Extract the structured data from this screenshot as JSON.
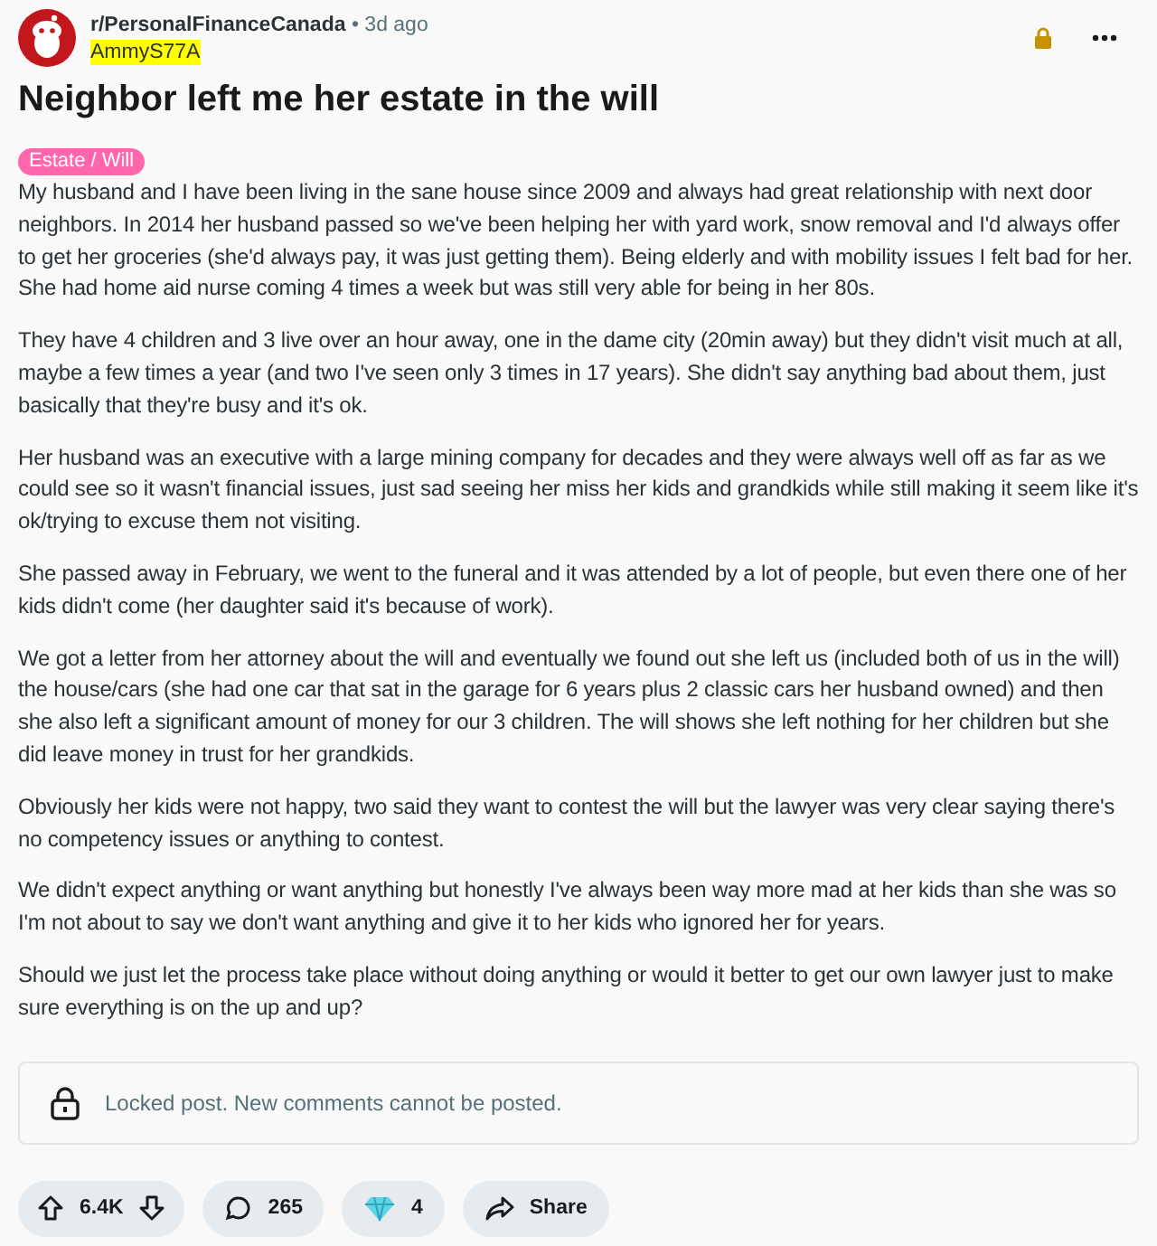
{
  "post": {
    "subreddit": "r/PersonalFinanceCanada",
    "time": "• 3d ago",
    "author": "AmmyS77A",
    "locked": true,
    "title": "Neighbor left me her estate in the will",
    "flair": "Estate / Will",
    "paragraphs": [
      "My husband and I have been living in the sane house since 2009 and always had great relationship with next door neighbors. In 2014 her husband passed so we've been helping her with yard work, snow removal and I'd always offer to get her groceries (she'd always pay, it was just getting them). Being elderly and with mobility issues I felt bad for her. She had home aid nurse coming 4 times a week but was still very able for being in her 80s.",
      "They have 4 children and 3 live over an hour away, one in the dame city (20min away) but they didn't visit much at all, maybe a few times a year (and two I've seen only 3 times in 17 years). She didn't say anything bad about them, just basically that they're busy and it's ok.",
      "Her husband was an executive with a large mining company for decades and they were always well off as far as we could see so it wasn't financial issues, just sad seeing her miss her kids and grandkids while still making it seem like it's ok/trying to excuse them not visiting.",
      "She passed away in February, we went to the funeral and it was attended by a lot of people, but even there one of her kids didn't come (her daughter said it's because of work).",
      "We got a letter from her attorney about the will and eventually we found out she left us (included both of us in the will) the house/cars (she had one car that sat in the garage for 6 years plus 2 classic cars her husband owned) and then she also left a significant amount of money for our 3 children. The will shows she left nothing for her children but she did leave money in trust for her grandkids.",
      "Obviously her kids were not happy, two said they want to contest the will but the lawyer was very clear saying there's no competency issues or anything to contest.",
      "We didn't expect anything or want anything but honestly I've always been way more mad at her kids than she was so I'm not about to say we don't want anything and give it to her kids who ignored her for years.",
      "Should we just let the process take place without doing anything or would it better to get our own lawyer just to make sure everything is on the up and up?"
    ],
    "locked_notice": "Locked post. New comments cannot be posted.",
    "actions": [
      {
        "kind": "vote",
        "label": "6.4K"
      },
      {
        "kind": "comments",
        "label": "265"
      },
      {
        "kind": "awards",
        "label": "4"
      },
      {
        "kind": "share",
        "label": "Share"
      }
    ]
  }
}
